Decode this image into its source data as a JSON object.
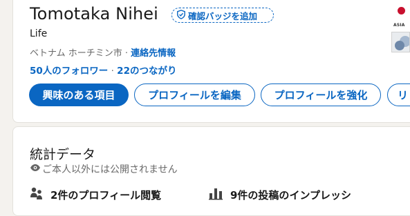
{
  "profile": {
    "name": "Tomotaka Nihei",
    "verify_badge_label": "確認バッジを追加",
    "headline": "Life",
    "location": "ベトナム ホーチミン市",
    "location_separator": " · ",
    "contact_info_label": "連絡先情報",
    "followers_label": "50人のフォロワー",
    "connections_separator": " · ",
    "connections_label": "22のつながり",
    "logo_text": "ASIA"
  },
  "actions": {
    "interests_label": "興味のある項目",
    "edit_profile_label": "プロフィールを編集",
    "enhance_profile_label": "プロフィールを強化",
    "more_label": "リ"
  },
  "stats": {
    "title": "統計データ",
    "privacy_note": "ご本人以外には公開されません",
    "profile_views_label": "2件のプロフィール閲覧",
    "post_impressions_label": "9件の投稿のインプレッシ"
  },
  "colors": {
    "accent": "#0a66c2",
    "page_background": "#f4f2ee",
    "card_background": "#ffffff"
  },
  "icons": {
    "badge": "shield-check-icon",
    "privacy": "eye-icon",
    "views": "people-icon",
    "impressions": "bar-chart-icon"
  }
}
